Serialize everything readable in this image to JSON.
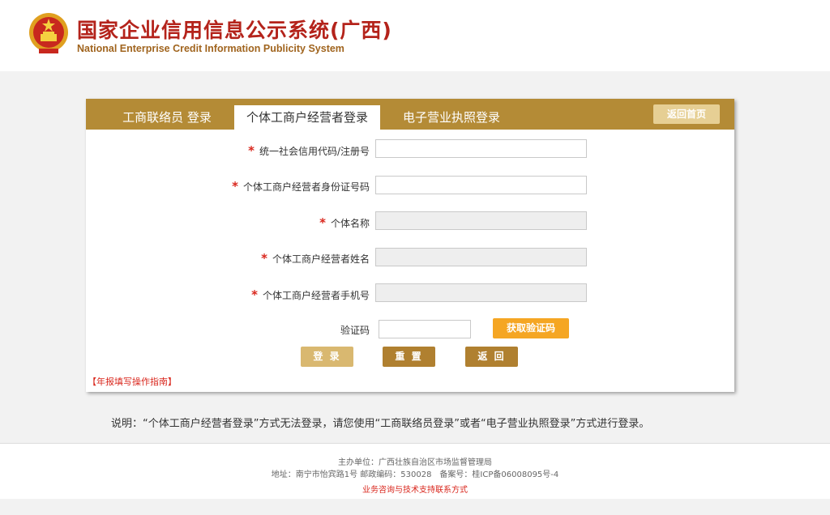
{
  "header": {
    "title_cn": "国家企业信用信息公示系统(广西)",
    "title_en": "National Enterprise Credit Information Publicity System",
    "emblem_icon": "national-emblem-icon"
  },
  "tabs": [
    {
      "label": "工商联络员 登录",
      "active": false
    },
    {
      "label": "个体工商户经营者登录",
      "active": true
    },
    {
      "label": "电子营业执照登录",
      "active": false
    }
  ],
  "back_home_label": "返回首页",
  "form": {
    "required_mark": "*",
    "fields": [
      {
        "label": "统一社会信用代码/注册号",
        "value": "",
        "disabled": false
      },
      {
        "label": "个体工商户经营者身份证号码",
        "value": "",
        "disabled": false
      },
      {
        "label": "个体名称",
        "value": "",
        "disabled": true
      },
      {
        "label": "个体工商户经营者姓名",
        "value": "",
        "disabled": true
      },
      {
        "label": "个体工商户经营者手机号",
        "value": "",
        "disabled": true
      }
    ],
    "captcha_label": "验证码",
    "captcha_value": "",
    "get_code_label": "获取验证码",
    "login_label": "登 录",
    "reset_label": "重 置",
    "back_label": "返 回",
    "guide_link": "【年报填写操作指南】"
  },
  "note": "说明：“个体工商户经营者登录”方式无法登录，请您使用“工商联络员登录”或者“电子营业执照登录”方式进行登录。",
  "footer": {
    "sponsor": "主办单位：广西壮族自治区市场监督管理局",
    "address": "地址：南宁市怡宾路1号 邮政编码：530028　备案号：桂ICP备06008095号-4",
    "contact_link": "业务咨询与技术支持联系方式"
  },
  "colors": {
    "brand_red": "#b4231b",
    "tab_bar_gold": "#b48b36",
    "login_button": "#d9b870",
    "reset_button": "#b08030",
    "get_code_button": "#f5a623"
  }
}
